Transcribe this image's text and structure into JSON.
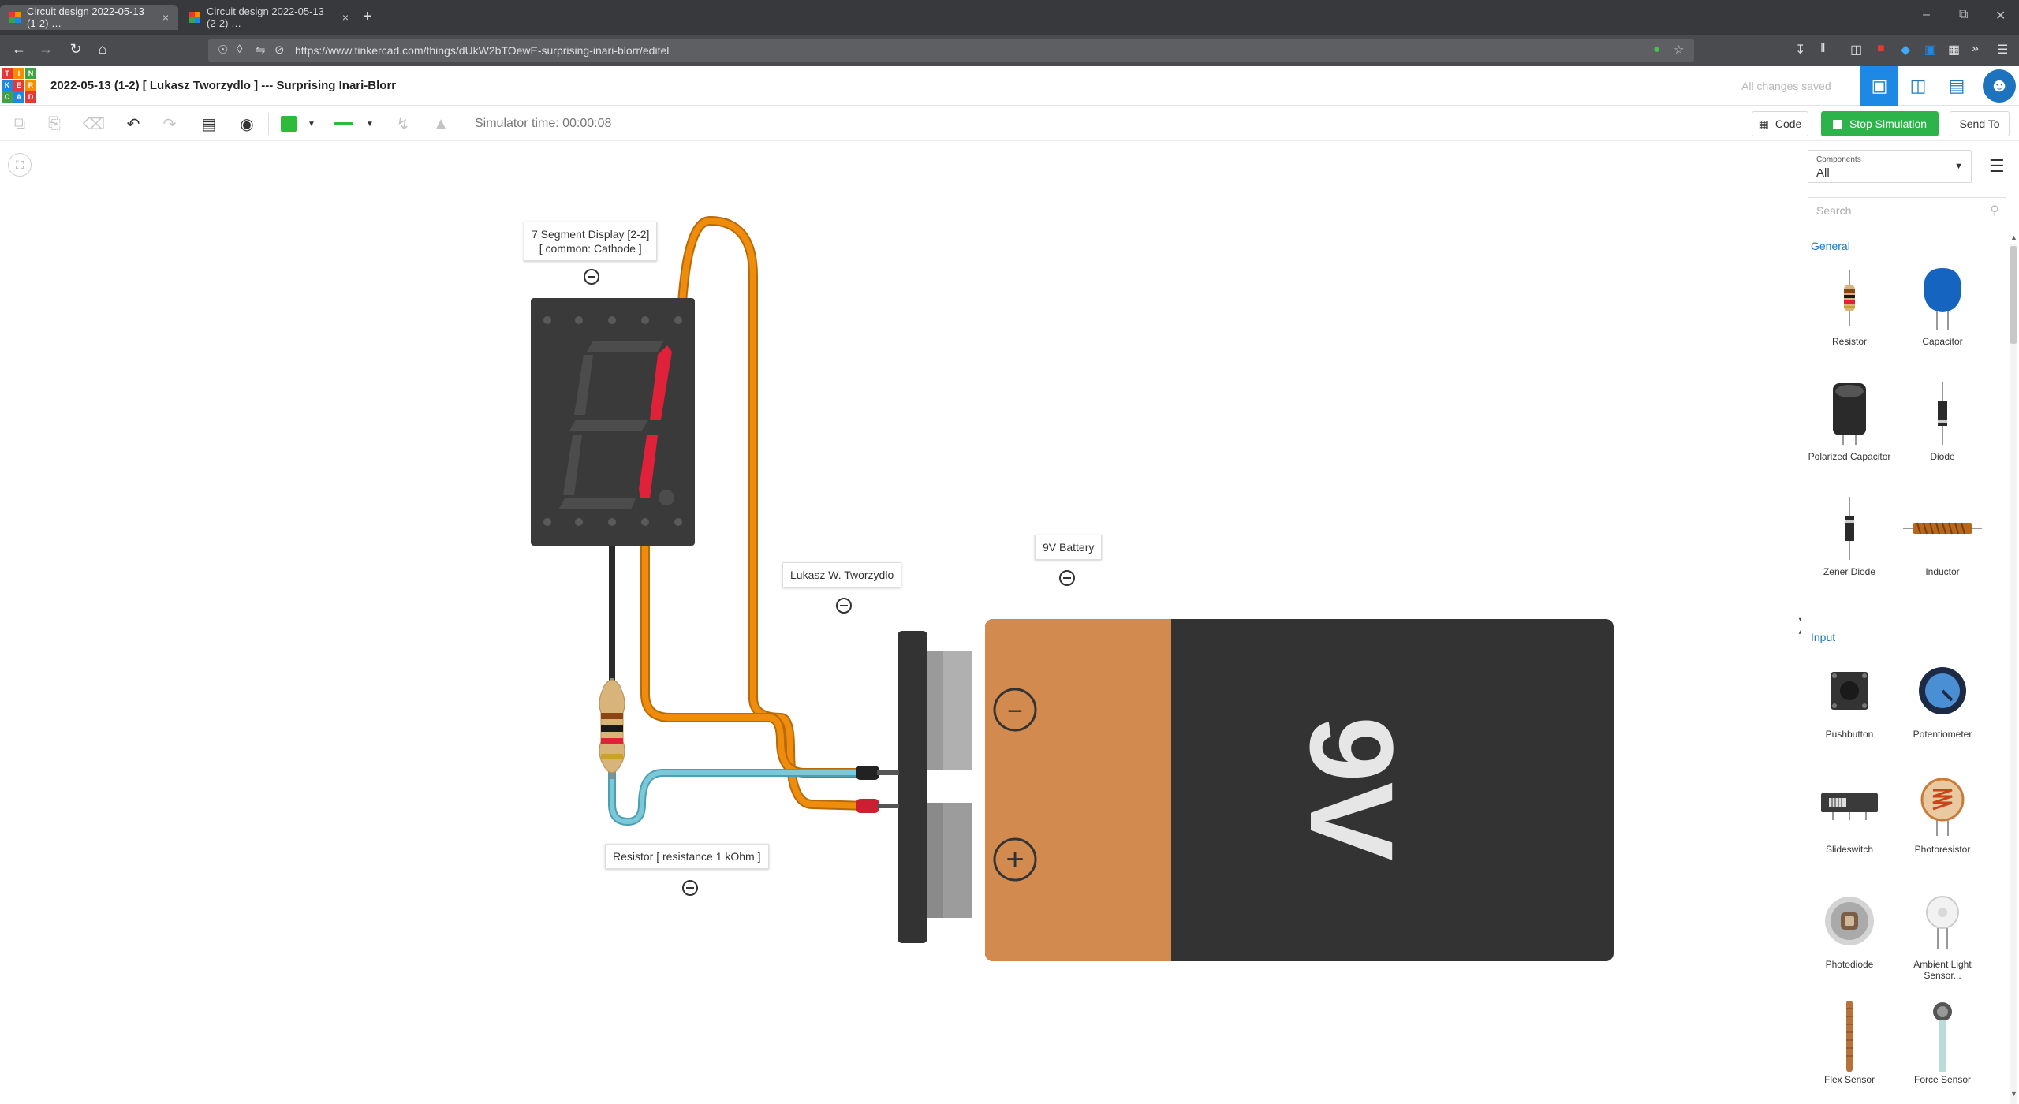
{
  "browser": {
    "tabs": [
      {
        "title": "Circuit design 2022-05-13 (1-2) …",
        "close": "×"
      },
      {
        "title": "Circuit design 2022-05-13 (2-2) …",
        "close": "×"
      }
    ],
    "new_tab": "+",
    "url": "https://www.tinkercad.com/things/dUkW2bTOewE-surprising-inari-blorr/editel",
    "window_controls": {
      "minimize": "–",
      "restore": "⧉",
      "close": "✕"
    }
  },
  "header": {
    "logo_letters": [
      "T",
      "I",
      "N",
      "K",
      "E",
      "R",
      "C",
      "A",
      "D"
    ],
    "title": "2022-05-13 (1-2) [ Lukasz Tworzydlo ] --- Surprising Inari-Blorr",
    "save_status": "All changes saved"
  },
  "toolbar": {
    "simulator_time": "Simulator time: 00:00:08",
    "code_label": "Code",
    "stop_label": "Stop Simulation",
    "send_label": "Send To",
    "wire_color": "#2dbb3a"
  },
  "canvas": {
    "labels": {
      "display_line1": "7 Segment Display [2-2]",
      "display_line2": "[ common: Cathode ]",
      "note": "Lukasz W. Tworzydlo",
      "battery": "9V Battery",
      "resistor": "Resistor [ resistance 1 kOhm ]"
    },
    "battery_text": "9V",
    "battery_minus": "−",
    "battery_plus": "+",
    "colors": {
      "wire_orange": "#f08c0c",
      "wire_blue": "#7cc8d8",
      "segment_on": "#e0213a",
      "segment_off": "#4a4a4a",
      "battery_body": "#333333",
      "battery_label": "#d28a4e"
    }
  },
  "panel": {
    "components_label": "Components",
    "components_value": "All",
    "search_placeholder": "Search",
    "sections": {
      "general": "General",
      "input": "Input"
    },
    "general_items": [
      "Resistor",
      "Capacitor",
      "Polarized Capacitor",
      "Diode",
      "Zener Diode",
      "Inductor"
    ],
    "input_items": [
      "Pushbutton",
      "Potentiometer",
      "Slideswitch",
      "Photoresistor",
      "Photodiode",
      "Ambient Light Sensor...",
      "Flex Sensor",
      "Force Sensor"
    ]
  }
}
